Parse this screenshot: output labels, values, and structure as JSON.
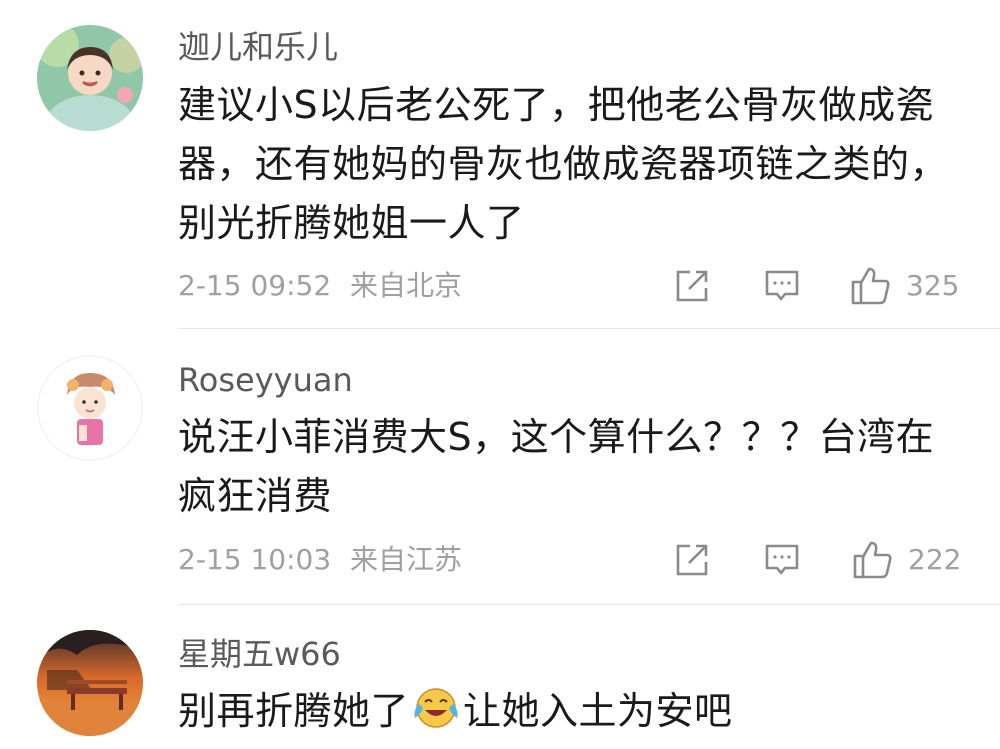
{
  "comments": [
    {
      "username": "迦儿和乐儿",
      "lines": [
        "建议小S以后老公死了，把他老公骨灰做成瓷",
        "器，还有她妈的骨灰也做成瓷器项链之类的，",
        "别光折腾她姐一人了"
      ],
      "date": "2-15 09:52",
      "location": "来自北京",
      "likes": "325",
      "icons": {
        "share": "share-icon",
        "reply": "comment-icon",
        "like": "thumbs-up-icon"
      }
    },
    {
      "username": "Roseyyuan",
      "lines": [
        "说汪小菲消费大S，这个算什么？？？台湾在",
        "疯狂消费"
      ],
      "date": "2-15 10:03",
      "location": "来自江苏",
      "likes": "222",
      "icons": {
        "share": "share-icon",
        "reply": "comment-icon",
        "like": "thumbs-up-icon"
      }
    },
    {
      "username": "星期五w66",
      "line_before_emoji": "别再折腾她了",
      "emoji": "crying-laughing-emoji",
      "line_after_emoji": "让她入土为安吧"
    }
  ],
  "colors": {
    "username": "#5a5a5a",
    "text": "#1a1a1a",
    "meta": "#a0a0a0",
    "divider": "#e6e6e6"
  }
}
